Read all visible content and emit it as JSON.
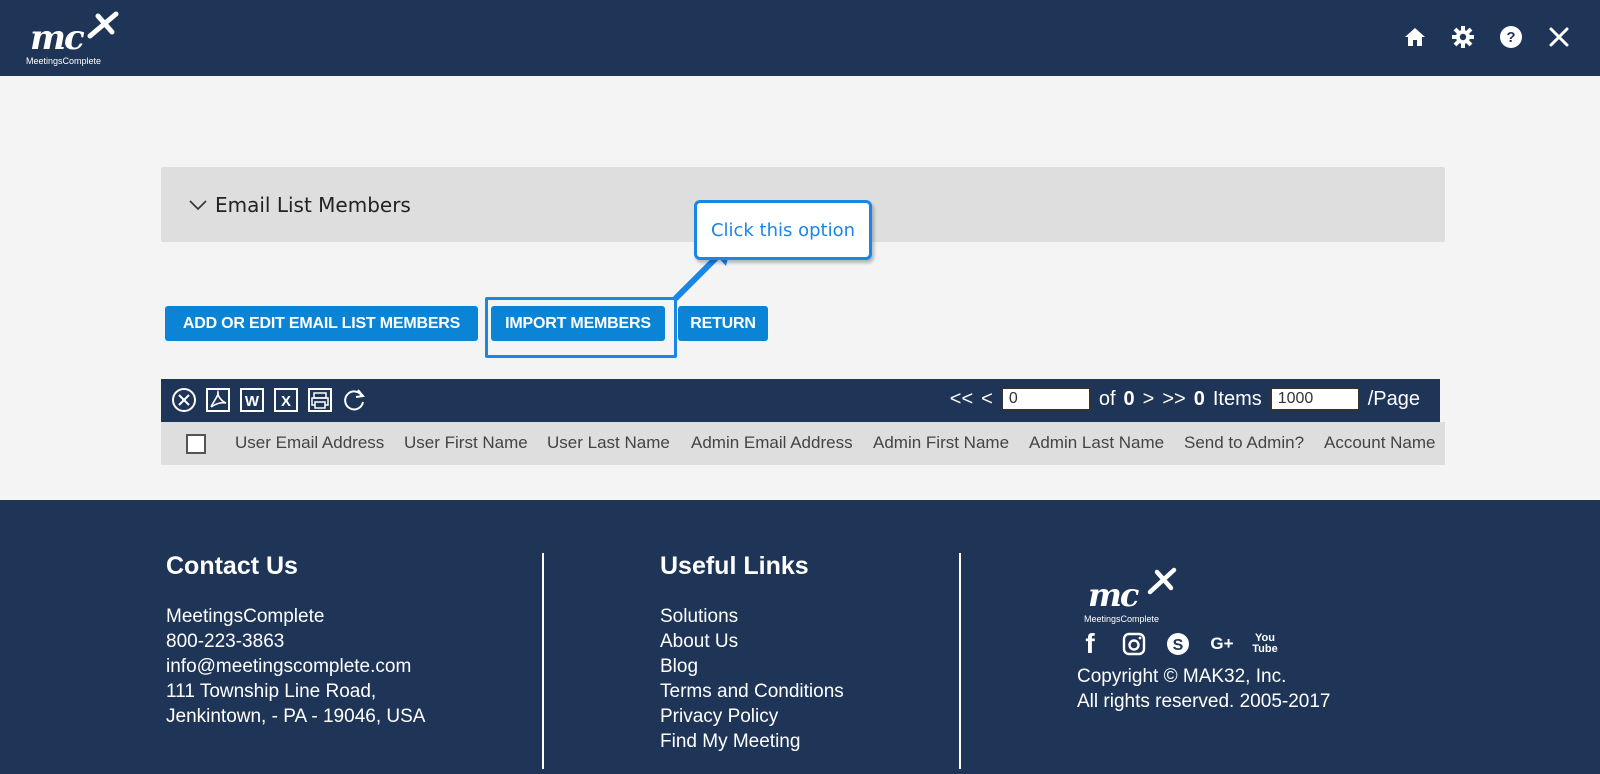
{
  "header": {
    "logo_text": "mc",
    "brand_name": "MeetingsComplete",
    "icons": [
      "home-icon",
      "gear-icon",
      "help-icon",
      "close-icon"
    ]
  },
  "panel": {
    "title": "Email List Members"
  },
  "actions": {
    "add_edit_label": "ADD OR EDIT EMAIL LIST MEMBERS",
    "import_label": "IMPORT MEMBERS",
    "return_label": "RETURN"
  },
  "callout": {
    "text": "Click this option"
  },
  "grid": {
    "toolbar_icons": [
      "clear-icon",
      "pdf-export-icon",
      "word-export-icon",
      "excel-export-icon",
      "print-icon",
      "refresh-icon"
    ],
    "pager": {
      "first": "<<",
      "prev": "<",
      "current_page": "0",
      "of_label": "of",
      "total_pages": "0",
      "next": ">",
      "last": ">>",
      "items_count": "0",
      "items_label": "Items",
      "page_size": "1000",
      "per_page_label": "/Page"
    },
    "columns": [
      "User Email Address",
      "User First Name",
      "User Last Name",
      "Admin Email Address",
      "Admin First Name",
      "Admin Last Name",
      "Send to Admin?",
      "Account Name"
    ]
  },
  "footer": {
    "contact": {
      "heading": "Contact Us",
      "lines": [
        "MeetingsComplete",
        "800-223-3863",
        "info@meetingscomplete.com",
        "111 Township Line Road,",
        "Jenkintown, - PA - 19046, USA"
      ]
    },
    "links": {
      "heading": "Useful Links",
      "items": [
        "Solutions",
        "About Us",
        "Blog",
        "Terms and Conditions",
        "Privacy Policy",
        "Find My Meeting"
      ]
    },
    "brand": {
      "logo_text": "mc",
      "brand_name": "MeetingsComplete",
      "socials": [
        "f",
        "G+",
        "You Tube"
      ],
      "copyright": "Copyright © MAK32, Inc.",
      "rights": "All rights reserved. 2005-2017"
    }
  }
}
